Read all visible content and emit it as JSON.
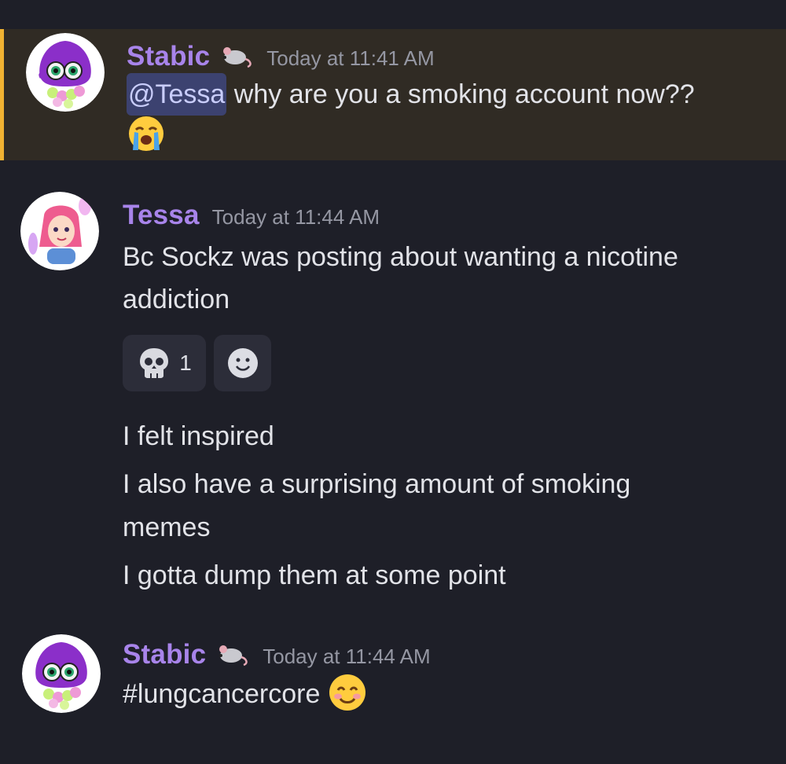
{
  "messages": [
    {
      "author": "Stabic",
      "badge_icon": "rat-icon",
      "timestamp": "Today at 11:41 AM",
      "mention": "@Tessa",
      "text": " why are you a smoking account now??",
      "emoji_icon": "loudly-crying-face-icon",
      "highlighted": true
    },
    {
      "author": "Tessa",
      "timestamp": "Today at 11:44 AM",
      "lines": [
        "Bc Sockz was posting about wanting a nicotine",
        "addiction"
      ],
      "reactions": [
        {
          "icon": "skull-icon",
          "count": "1"
        },
        {
          "icon": "add-reaction-icon"
        }
      ],
      "followups": [
        "I felt inspired",
        "I also have a surprising amount of smoking",
        "memes",
        "I gotta dump them at some point"
      ]
    },
    {
      "author": "Stabic",
      "badge_icon": "rat-icon",
      "timestamp": "Today at 11:44 AM",
      "text": "#lungcancercore",
      "emoji_icon": "smiling-face-with-smiling-eyes-icon"
    }
  ],
  "colors": {
    "background": "#1e1f28",
    "mention_highlight": "#302b24",
    "mention_bar": "#f0b232",
    "username": "#a884ea",
    "mention_pill": "#3c4270"
  }
}
